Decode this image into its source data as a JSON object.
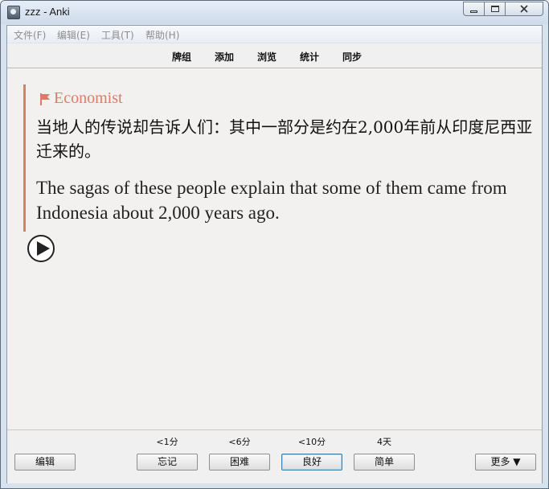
{
  "window": {
    "title": "zzz - Anki"
  },
  "menu": {
    "file": "文件(F)",
    "edit": "编辑(E)",
    "tools": "工具(T)",
    "help": "帮助(H)"
  },
  "toolbar": {
    "decks": "牌组",
    "add": "添加",
    "browse": "浏览",
    "stats": "统计",
    "sync": "同步"
  },
  "card": {
    "source": "Economist",
    "chinese": "当地人的传说却告诉人们：其中一部分是约在2,000年前从印度尼西亚迁来的。",
    "english": "The sagas of these people explain that some of them came from Indonesia about 2,000 years ago.",
    "accent_color": "#e07a6a"
  },
  "bottom": {
    "edit_label": "编辑",
    "more_label": "更多 ▼",
    "answers": [
      {
        "label": "忘记",
        "due": "<1分"
      },
      {
        "label": "困难",
        "due": "<6分"
      },
      {
        "label": "良好",
        "due": "<10分"
      },
      {
        "label": "简单",
        "due": "4天"
      }
    ]
  },
  "icons": {
    "app": "anki-app-icon",
    "flag": "flag-icon",
    "play": "play-icon"
  }
}
